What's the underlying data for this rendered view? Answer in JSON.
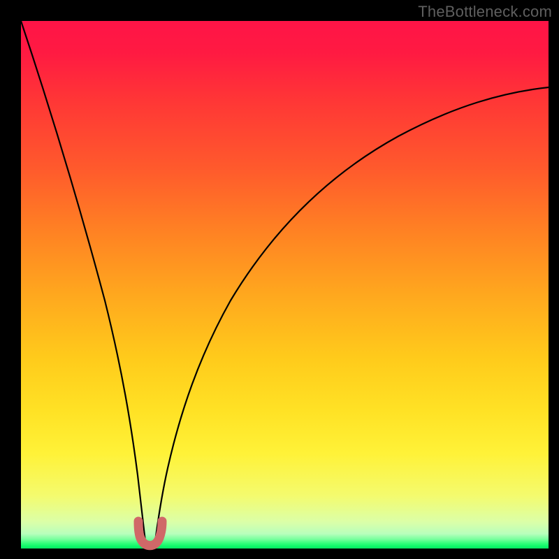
{
  "watermark": "TheBottleneck.com",
  "chart_data": {
    "type": "line",
    "title": "",
    "xlabel": "",
    "ylabel": "",
    "xlim": [
      0,
      1
    ],
    "ylim": [
      0,
      1
    ],
    "note": "Bottleneck curve. Y-axis runs top→bottom as 1→0 (high bottleneck at top / red, zero at bottom / green). The minimum sits near x≈0.24 where a short pink U-shaped marker highlights the sweet spot.",
    "series": [
      {
        "name": "bottleneck-curve",
        "x": [
          0.0,
          0.04,
          0.08,
          0.12,
          0.16,
          0.19,
          0.21,
          0.225,
          0.24,
          0.26,
          0.275,
          0.29,
          0.32,
          0.36,
          0.41,
          0.47,
          0.55,
          0.64,
          0.74,
          0.86,
          1.0
        ],
        "y": [
          1.0,
          0.82,
          0.65,
          0.48,
          0.32,
          0.19,
          0.11,
          0.045,
          0.0,
          0.045,
          0.11,
          0.17,
          0.27,
          0.37,
          0.47,
          0.56,
          0.64,
          0.71,
          0.77,
          0.82,
          0.86
        ]
      }
    ],
    "marker": {
      "name": "sweet-spot",
      "x": 0.24,
      "width": 0.035,
      "color": "#d46a6a"
    },
    "gradient_stops": [
      {
        "pos": 0.0,
        "color": "#ff1447"
      },
      {
        "pos": 0.28,
        "color": "#ff5a2c"
      },
      {
        "pos": 0.64,
        "color": "#ffcb1b"
      },
      {
        "pos": 0.9,
        "color": "#f4fb6e"
      },
      {
        "pos": 0.985,
        "color": "#33ff7a"
      },
      {
        "pos": 1.0,
        "color": "#09e462"
      }
    ]
  }
}
